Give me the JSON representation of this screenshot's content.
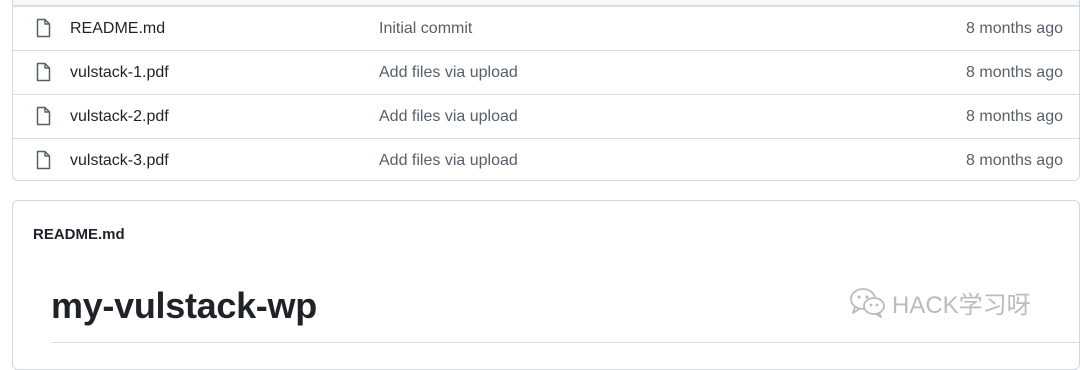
{
  "files": [
    {
      "name": "README.md",
      "message": "Initial commit",
      "age": "8 months ago"
    },
    {
      "name": "vulstack-1.pdf",
      "message": "Add files via upload",
      "age": "8 months ago"
    },
    {
      "name": "vulstack-2.pdf",
      "message": "Add files via upload",
      "age": "8 months ago"
    },
    {
      "name": "vulstack-3.pdf",
      "message": "Add files via upload",
      "age": "8 months ago"
    }
  ],
  "readme": {
    "filename": "README.md",
    "heading": "my-vulstack-wp"
  },
  "watermark": {
    "text": "HACK学习呀",
    "icon": "wechat-icon"
  },
  "colors": {
    "text": "#1f2328",
    "muted": "#57606a",
    "border": "#d0d7de"
  }
}
